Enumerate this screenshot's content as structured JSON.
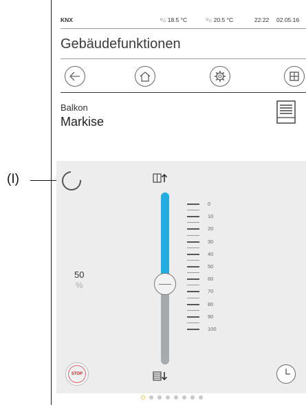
{
  "status_bar": {
    "app": "KNX",
    "outdoor_temp": "18.5 °C",
    "indoor_temp": "20.5 °C",
    "time": "22:22",
    "date": "02.05.16"
  },
  "title": "Gebäudefunktionen",
  "nav": [
    "back-icon",
    "home-icon",
    "settings-gear-icon",
    "grid-icon"
  ],
  "room": "Balkon",
  "device": "Markise",
  "callout_label": "(I)",
  "position": {
    "value": "50",
    "unit": "%",
    "fraction": 0.5
  },
  "scale_labels": [
    "0",
    "10",
    "20",
    "30",
    "40",
    "50",
    "60",
    "70",
    "80",
    "90",
    "100"
  ],
  "buttons": {
    "stop": "STOP"
  },
  "pages": {
    "count": 8,
    "active": 0
  },
  "colors": {
    "accent": "#21ace2",
    "track": "#a6aaad",
    "panel": "#ededee"
  }
}
